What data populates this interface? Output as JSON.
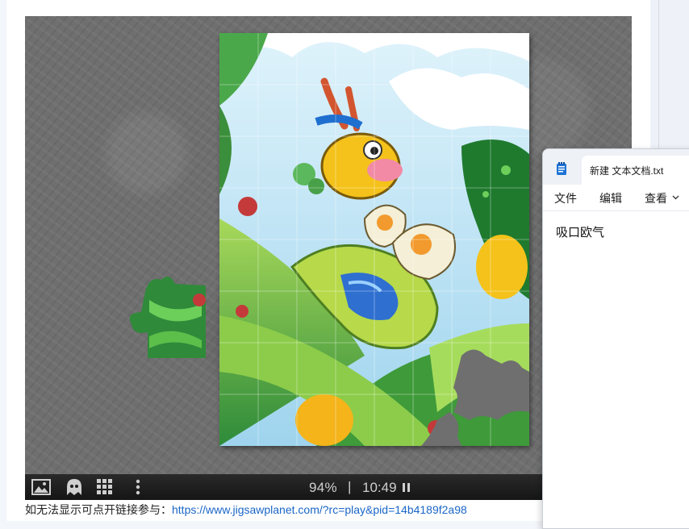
{
  "puzzle": {
    "progress": "94%",
    "separator": "|",
    "timer": "10:49",
    "tools": [
      "image-icon",
      "ghost-icon",
      "grid-icon",
      "more-icon",
      "pause-icon"
    ]
  },
  "footer": {
    "prefix": "如无法显示可点开链接参与：",
    "link": "https://www.jigsawplanet.com/?rc=play&pid=14b4189f2a98"
  },
  "notepad": {
    "tab_title": "新建 文本文档.txt",
    "menu": [
      "文件",
      "编辑",
      "查看"
    ],
    "content": "吸口欧气"
  },
  "colors": {
    "board": "#6f6f6f",
    "toolbar": "#1c1c1c",
    "link": "#1a66c7",
    "puzzle_green": "#3f9a3a",
    "puzzle_sky": "#bfe6f6"
  }
}
